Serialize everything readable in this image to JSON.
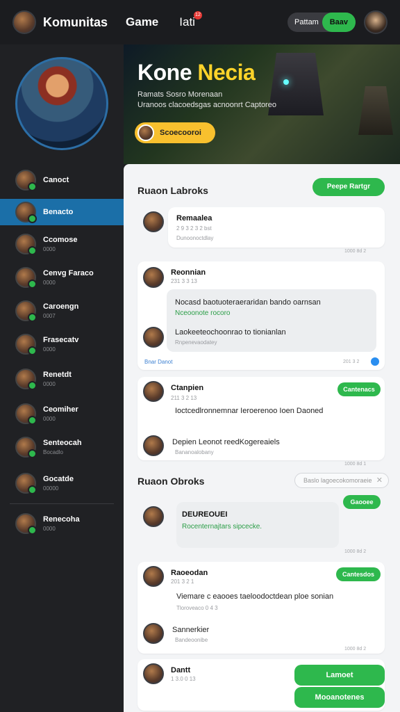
{
  "topbar": {
    "app_title": "Komunitas",
    "nav_game": "Game",
    "nav_last": "Iati",
    "nav_badge": "12",
    "toggle_left": "Pattam",
    "toggle_right": "Baav"
  },
  "sidebar": {
    "items": [
      {
        "name": "Canoct",
        "sub": ""
      },
      {
        "name": "Benacto",
        "sub": ""
      },
      {
        "name": "Ccomose",
        "sub": "0000"
      },
      {
        "name": "Cenvg Faraco",
        "sub": "0000"
      },
      {
        "name": "Caroengn",
        "sub": "0007"
      },
      {
        "name": "Frasecatv",
        "sub": "0000"
      },
      {
        "name": "Renetdt",
        "sub": "0000"
      },
      {
        "name": "Ceomiher",
        "sub": "0000"
      },
      {
        "name": "Senteocah",
        "sub": "Bocadlo"
      },
      {
        "name": "Gocatde",
        "sub": "00000"
      },
      {
        "name": "Renecoha",
        "sub": "0000"
      }
    ]
  },
  "banner": {
    "title_white": "Kone",
    "title_yellow": "Necia",
    "line1": "Ramats Sosro Morenaan",
    "line2": "Uranoos clacoedsgas acnoonrt Captoreo",
    "button": "Scoecooroi"
  },
  "main": {
    "section1_title": "Ruaon Labroks",
    "section1_btn": "Peepe Rartgr",
    "post1": {
      "name": "Remaalea",
      "meta": "2 9 3 2 3 2 bst",
      "sub": "Dunoonoctdlay",
      "time": "1000 8d 2"
    },
    "post2": {
      "name": "Reonnian",
      "meta": "231 3 3 13",
      "bubble_line1": "Nocasd baotuoteraeraridan bando oarnsan",
      "bubble_green": "Nceoonote rocoro",
      "bubble_line2": "Laokeeteochoonrao to tionianlan",
      "bubble_sub": "Rnpenevaodatey",
      "footer_left": "Bnar Danot",
      "time": "201 3 2"
    },
    "post3": {
      "name": "Ctanpien",
      "meta": "211 3 2 13",
      "pill": "Cantenacs",
      "text": "Ioctcedlronnemnar Ieroerenoo Ioen Daoned",
      "reply_name": "Depien Leonot reedKogereaiels",
      "reply_sub": "Bananoalobany",
      "time": "1000 8d 1"
    },
    "section2_title": "Ruaon Obroks",
    "search_placeholder": "Baslo lagoecokomoraeie",
    "post4": {
      "pill": "Gaooee",
      "name": "DEUREOUEI",
      "green": "Rocenternajtars sipcecke.",
      "time": "1000 8d 2"
    },
    "post5": {
      "name": "Raoeodan",
      "meta": "201 3 2 1",
      "pill": "Cantesdos",
      "text": "Viemare c eaooes taeloodoctdean ploe sonian",
      "sub": "Tloroveaco 0 4 3",
      "reply_name": "Sannerkier",
      "reply_sub": "Bandeoonibe",
      "time": "1000 8d 2"
    },
    "post6": {
      "name": "Dantt",
      "meta": "1 3.0 0 13",
      "btn1": "Lamoet",
      "btn2": "Mooanotenes"
    }
  },
  "colors": {
    "accent": "#2eb84d",
    "highlight": "#ffd42a",
    "active": "#1b6fa8"
  }
}
